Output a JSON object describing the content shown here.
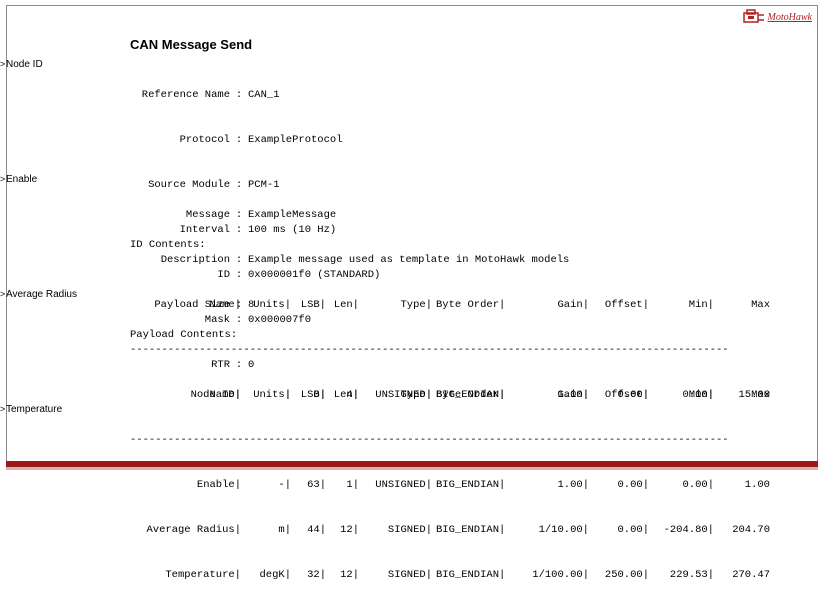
{
  "block": {
    "title": "CAN Message Send",
    "logo_text": "MotoHawk",
    "ports": [
      "Node ID",
      "Enable",
      "Average Radius",
      "Temperature"
    ],
    "arrow": ">"
  },
  "config": {
    "reference_name": {
      "key": "Reference Name",
      "value": "CAN_1"
    },
    "protocol": {
      "key": "Protocol",
      "value": "ExampleProtocol"
    },
    "source_module": {
      "key": "Source Module",
      "value": "PCM-1"
    },
    "interval": {
      "key": "Interval",
      "value": "100 ms (10 Hz)"
    },
    "id": {
      "key": "ID",
      "value": "0x000001f0 (STANDARD)"
    },
    "mask": {
      "key": "Mask",
      "value": "0x000007f0"
    },
    "rtr": {
      "key": "RTR",
      "value": "0"
    },
    "message": {
      "key": "Message",
      "value": "ExampleMessage"
    },
    "description": {
      "key": "Description",
      "value": "Example message used as template in MotoHawk models"
    },
    "payload_size": {
      "key": "Payload Size",
      "value": "8"
    },
    "separator": ":"
  },
  "id_contents": {
    "heading": "ID Contents:",
    "rows": [
      {
        "name": "Node ID|",
        "units": "|",
        "lsb": "0|",
        "len": "4|",
        "type": "UNSIGNED|",
        "byte_order": "BIG_ENDIAN|",
        "gain": "1.00|",
        "offset": "0.00|",
        "min": "0.00|",
        "max": "15.00"
      }
    ]
  },
  "payload_contents": {
    "heading": "Payload Contents:",
    "rows": [
      {
        "name": "Enable|",
        "units": "-|",
        "lsb": "63|",
        "len": "1|",
        "type": "UNSIGNED|",
        "byte_order": "BIG_ENDIAN|",
        "gain": "1.00|",
        "offset": "0.00|",
        "min": "0.00|",
        "max": "1.00"
      },
      {
        "name": "Average Radius|",
        "units": "m|",
        "lsb": "44|",
        "len": "12|",
        "type": "SIGNED|",
        "byte_order": "BIG_ENDIAN|",
        "gain": "1/10.00|",
        "offset": "0.00|",
        "min": "-204.80|",
        "max": "204.70"
      },
      {
        "name": "Temperature|",
        "units": "degK|",
        "lsb": "32|",
        "len": "12|",
        "type": "SIGNED|",
        "byte_order": "BIG_ENDIAN|",
        "gain": "1/100.00|",
        "offset": "250.00|",
        "min": "229.53|",
        "max": "270.47"
      }
    ]
  },
  "table_header": {
    "name": "Name|",
    "units": "Units|",
    "lsb": "LSB|",
    "len": "Len|",
    "type": "Type|",
    "byte_order": "Byte Order|",
    "gain": "Gain|",
    "offset": "Offset|",
    "min": "Min|",
    "max": "Max"
  },
  "divider": "-----------------------------------------------------------------------------------------------"
}
